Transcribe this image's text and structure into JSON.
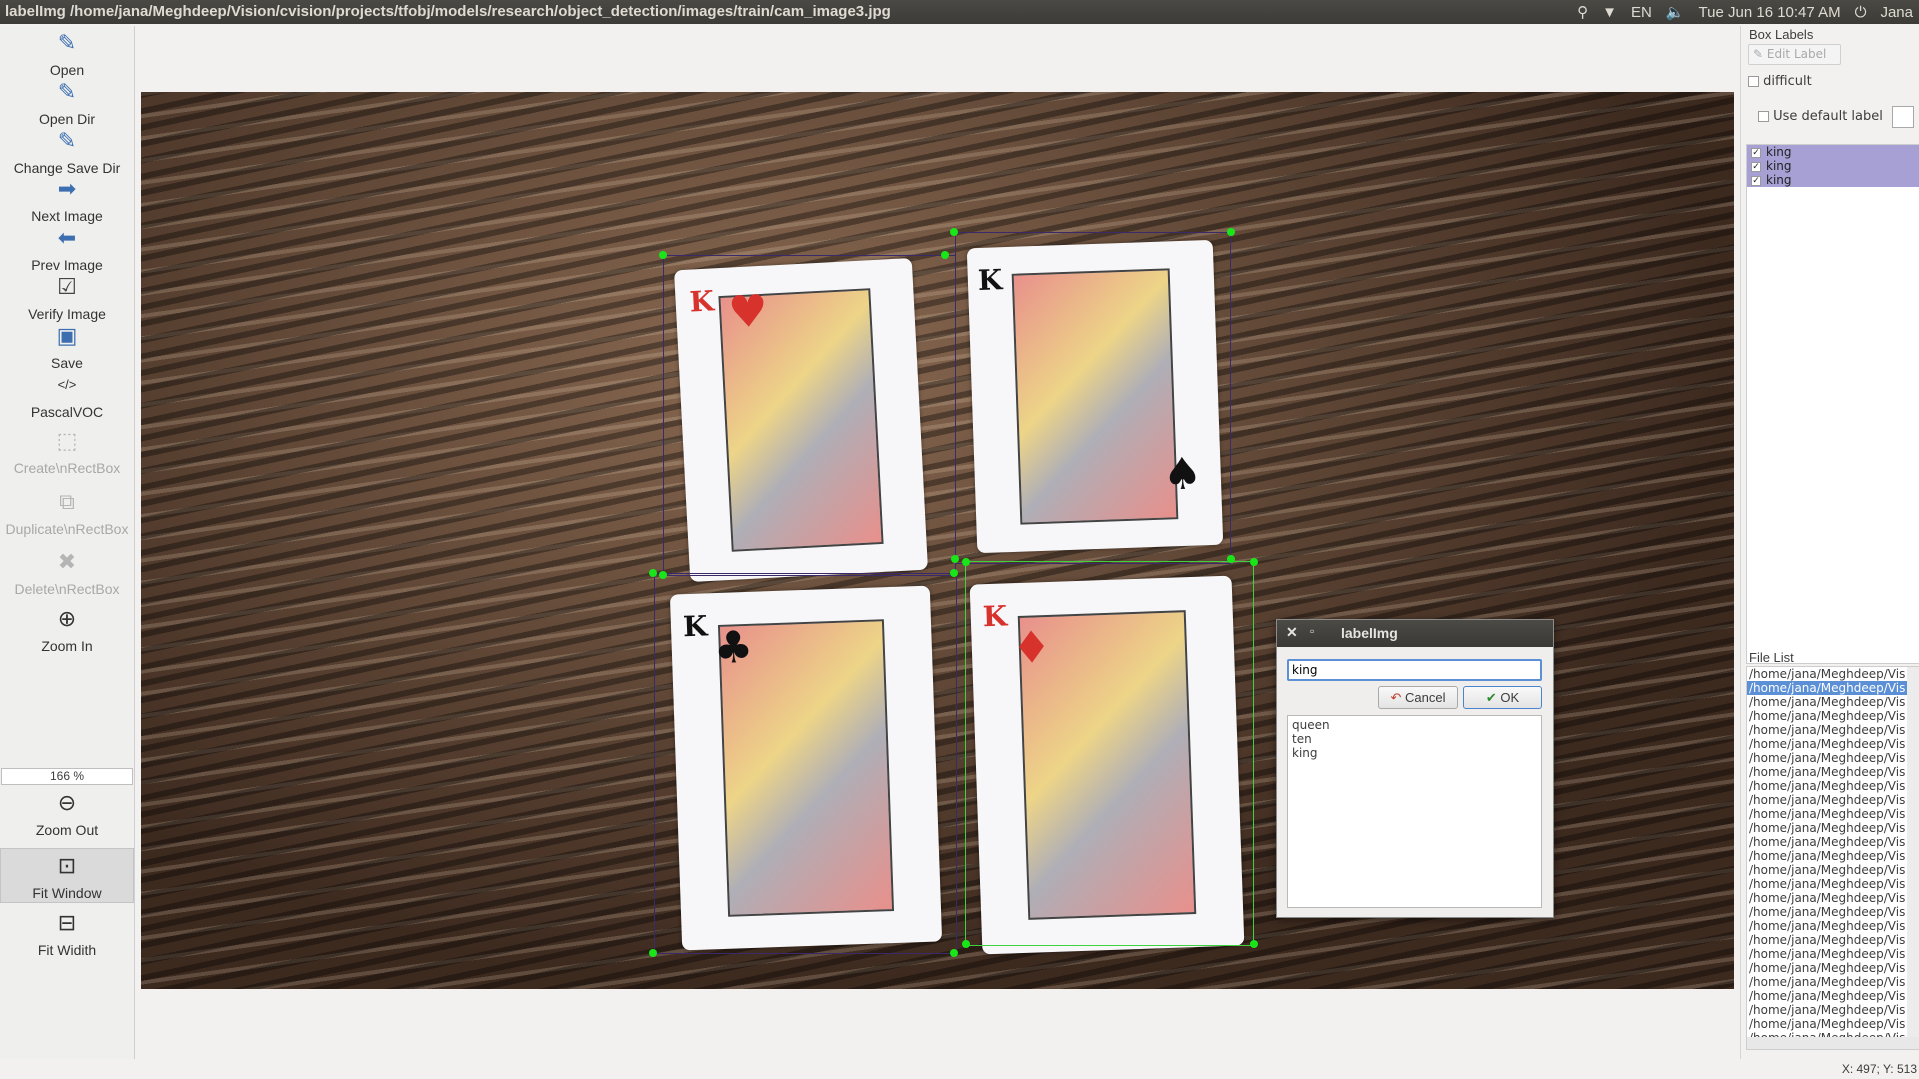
{
  "window": {
    "title": "labelImg /home/jana/Meghdeep/Vision/cvision/projects/tfobj/models/research/object_detection/images/train/cam_image3.jpg"
  },
  "tray": {
    "lang": "EN",
    "datetime": "Tue Jun 16 10:47 AM",
    "user": "Jana",
    "icons": [
      "location-icon",
      "wifi-icon",
      "volume-icon",
      "power-icon"
    ]
  },
  "toolbar": {
    "items": [
      {
        "label": "Open",
        "icon": "open-icon",
        "disabled": false
      },
      {
        "label": "Open Dir",
        "icon": "open-dir-icon",
        "disabled": false
      },
      {
        "label": "Change Save Dir",
        "icon": "change-save-dir-icon",
        "disabled": false
      },
      {
        "label": "Next Image",
        "icon": "next-arrow-icon",
        "disabled": false
      },
      {
        "label": "Prev Image",
        "icon": "prev-arrow-icon",
        "disabled": false
      },
      {
        "label": "Verify Image",
        "icon": "verify-icon",
        "disabled": false
      },
      {
        "label": "Save",
        "icon": "save-icon",
        "disabled": false
      },
      {
        "label": "PascalVOC",
        "icon": "code-icon",
        "disabled": false
      },
      {
        "label": "Create\\nRectBox",
        "icon": "create-rectbox-icon",
        "disabled": true
      },
      {
        "label": "Duplicate\\nRectBox",
        "icon": "duplicate-icon",
        "disabled": true
      },
      {
        "label": "Delete\\nRectBox",
        "icon": "delete-icon",
        "disabled": true
      },
      {
        "label": "Zoom In",
        "icon": "zoom-in-icon",
        "disabled": false
      },
      {
        "label": "Zoom Out",
        "icon": "zoom-out-icon",
        "disabled": false
      },
      {
        "label": "Fit Window",
        "icon": "fit-window-icon",
        "disabled": false
      },
      {
        "label": "Fit Widith",
        "icon": "fit-width-icon",
        "disabled": false
      }
    ],
    "zoom": "166 %"
  },
  "dialog": {
    "title": "labelImg",
    "input_value": "king",
    "cancel_label": "Cancel",
    "ok_label": "OK",
    "options": [
      "queen",
      "ten",
      "king"
    ]
  },
  "dock": {
    "box_labels_title": "Box Labels",
    "edit_label": "Edit Label",
    "difficult_label": "difficult",
    "use_default_label": "Use default label",
    "labels": [
      "king",
      "king",
      "king"
    ],
    "file_list_title": "File List",
    "file_entry": "/home/jana/Meghdeep/Vis",
    "file_count": 27,
    "selected_index": 1
  },
  "cards": [
    {
      "rank": "K",
      "suit": "♥",
      "color": "red"
    },
    {
      "rank": "K",
      "suit": "♠",
      "color": "blk"
    },
    {
      "rank": "K",
      "suit": "♣",
      "color": "blk"
    },
    {
      "rank": "K",
      "suit": "♦",
      "color": "red"
    }
  ],
  "status": {
    "coords": "X: 497; Y: 513"
  },
  "colors": {
    "selection": "#5b8fd6",
    "label_highlight": "#a6a0d4",
    "point": "#19e619"
  }
}
